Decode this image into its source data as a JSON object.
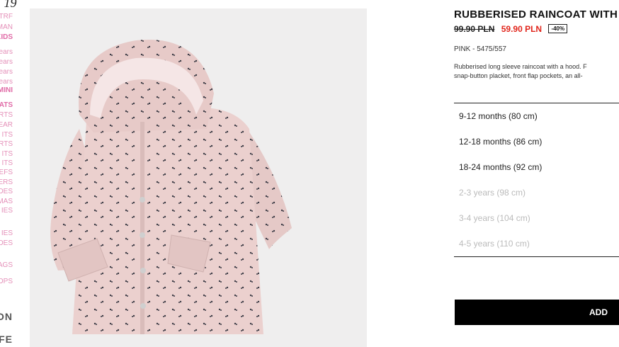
{
  "menu": {
    "brand": "ON 19",
    "items": [
      "TRF",
      "MAN",
      "KIDS",
      "ears",
      "ears",
      "ears",
      "ears",
      "MINI",
      "ATS",
      "RTS",
      "EAR",
      "ITS",
      "RTS",
      "ITS",
      "ITS",
      "EFS",
      "ERS",
      "DES",
      "MAS",
      "IES",
      "IES",
      "DES",
      "AGS",
      "OPS"
    ],
    "bottom": [
      "ON",
      "FE"
    ]
  },
  "product": {
    "title": "RUBBERISED RAINCOAT WITH",
    "old_price": "99.90 PLN",
    "new_price": "59.90 PLN",
    "discount": "-40%",
    "color_ref": "PINK - 5475/557",
    "description_line1": "Rubberised long sleeve raincoat with a hood. F",
    "description_line2": "snap-button placket, front flap pockets, an all-",
    "sizes": [
      {
        "label": "9-12 months (80 cm)",
        "available": true
      },
      {
        "label": "12-18 months (86 cm)",
        "available": true
      },
      {
        "label": "18-24 months (92 cm)",
        "available": true
      },
      {
        "label": "2-3 years (98 cm)",
        "available": false
      },
      {
        "label": "3-4 years (104 cm)",
        "available": false
      },
      {
        "label": "4-5 years (110 cm)",
        "available": false
      }
    ],
    "add_label": "ADD"
  }
}
